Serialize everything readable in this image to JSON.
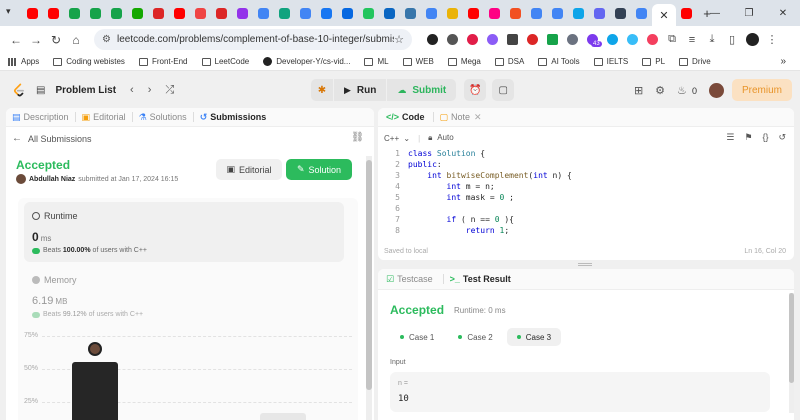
{
  "browser": {
    "tab_favicons": [
      {
        "icon": "youtube-icon",
        "color": "#ff0000"
      },
      {
        "icon": "youtube-icon",
        "color": "#ff0000"
      },
      {
        "icon": "green-app-icon",
        "color": "#16a34a"
      },
      {
        "icon": "green-app-icon",
        "color": "#16a34a"
      },
      {
        "icon": "green-app-icon",
        "color": "#16a34a"
      },
      {
        "icon": "upwork-icon",
        "color": "#14a800"
      },
      {
        "icon": "gmail-icon",
        "color": "#dc2626"
      },
      {
        "icon": "youtube-icon",
        "color": "#ff0000"
      },
      {
        "icon": "red-app-icon",
        "color": "#ef4444"
      },
      {
        "icon": "gmail-icon",
        "color": "#dc2626"
      },
      {
        "icon": "purple-app-icon",
        "color": "#9333ea"
      },
      {
        "icon": "google-icon",
        "color": "#4285f4"
      },
      {
        "icon": "chatgpt-icon",
        "color": "#10a37f"
      },
      {
        "icon": "google-icon",
        "color": "#4285f4"
      },
      {
        "icon": "facebook-icon",
        "color": "#1877f2"
      },
      {
        "icon": "meta-icon",
        "color": "#0668e1"
      },
      {
        "icon": "green-app-icon",
        "color": "#22c55e"
      },
      {
        "icon": "linkedin-icon",
        "color": "#0a66c2"
      },
      {
        "icon": "python-icon",
        "color": "#3776ab"
      },
      {
        "icon": "google-icon",
        "color": "#4285f4"
      },
      {
        "icon": "yellow-app-icon",
        "color": "#eab308"
      },
      {
        "icon": "youtube-icon",
        "color": "#ff0000"
      },
      {
        "icon": "flickr-icon",
        "color": "#ff0084"
      },
      {
        "icon": "microsoft-icon",
        "color": "#f25022"
      },
      {
        "icon": "chrome-icon",
        "color": "#4285f4"
      },
      {
        "icon": "google-icon",
        "color": "#4285f4"
      },
      {
        "icon": "blue-app-icon",
        "color": "#0ea5e9"
      },
      {
        "icon": "shield-icon",
        "color": "#6366f1"
      },
      {
        "icon": "hat-icon",
        "color": "#334155"
      },
      {
        "icon": "google-icon",
        "color": "#4285f4"
      }
    ],
    "trailing_favicon": {
      "icon": "youtube-icon",
      "color": "#ff0000"
    },
    "active_tab_close": "✕",
    "new_tab": "+",
    "window_controls": [
      "—",
      "❐",
      "✕"
    ],
    "url": "leetcode.com/problems/complement-of-base-10-integer/submission...",
    "extension_badge": "43",
    "bookmarks": [
      {
        "label": "Apps",
        "icon": "apps-grid-icon"
      },
      {
        "label": "Coding webistes",
        "icon": "folder-icon"
      },
      {
        "label": "Front-End",
        "icon": "folder-icon"
      },
      {
        "label": "LeetCode",
        "icon": "folder-icon"
      },
      {
        "label": "Developer-Y/cs-vid...",
        "icon": "github-icon"
      },
      {
        "label": "ML",
        "icon": "folder-icon"
      },
      {
        "label": "WEB",
        "icon": "folder-icon"
      },
      {
        "label": "Mega",
        "icon": "folder-icon"
      },
      {
        "label": "DSA",
        "icon": "folder-icon"
      },
      {
        "label": "AI Tools",
        "icon": "folder-icon"
      },
      {
        "label": "IELTS",
        "icon": "folder-icon"
      },
      {
        "label": "PL",
        "icon": "folder-icon"
      },
      {
        "label": "Drive",
        "icon": "folder-icon"
      }
    ],
    "bookmarks_more": "»"
  },
  "header": {
    "problem_list": "Problem List",
    "run": "Run",
    "submit": "Submit",
    "streak_count": "0",
    "premium": "Premium"
  },
  "left_panel": {
    "tabs": [
      "Description",
      "Editorial",
      "Solutions",
      "Submissions"
    ],
    "all_submissions": "All Submissions",
    "status": "Accepted",
    "author": "Abdullah Niaz",
    "submitted_at": "submitted at Jan 17, 2024 16:15",
    "editorial_button": "Editorial",
    "solution_button": "Solution",
    "runtime": {
      "label": "Runtime",
      "value": "0",
      "unit": "ms",
      "beats_prefix": "Beats",
      "beats_pct": "100.00%",
      "beats_suffix": "of users with C++"
    },
    "memory": {
      "label": "Memory",
      "value": "6.19",
      "unit": "MB",
      "beats_prefix": "Beats",
      "beats_pct": "99.12%",
      "beats_suffix": "of users with C++"
    }
  },
  "chart_data": {
    "type": "bar",
    "y_ticks": [
      "75%",
      "50%",
      "25%"
    ],
    "yunit": "%",
    "ylim": [
      0,
      100
    ],
    "values": [
      55,
      17
    ]
  },
  "code_panel": {
    "tabs": [
      "Code",
      "Note"
    ],
    "language": "C++",
    "mode": "Auto",
    "lines": [
      {
        "n": "1",
        "segments": [
          {
            "t": "class ",
            "c": "kw"
          },
          {
            "t": "Solution",
            "c": "ty"
          },
          {
            "t": " {",
            "c": ""
          }
        ]
      },
      {
        "n": "2",
        "segments": [
          {
            "t": "public",
            "c": "kw"
          },
          {
            "t": ":",
            "c": ""
          }
        ]
      },
      {
        "n": "3",
        "segments": [
          {
            "t": "    ",
            "c": ""
          },
          {
            "t": "int ",
            "c": "kw"
          },
          {
            "t": "bitwiseComplement",
            "c": "fn"
          },
          {
            "t": "(",
            "c": ""
          },
          {
            "t": "int ",
            "c": "kw"
          },
          {
            "t": "n) {",
            "c": ""
          }
        ]
      },
      {
        "n": "4",
        "segments": [
          {
            "t": "        ",
            "c": ""
          },
          {
            "t": "int ",
            "c": "kw"
          },
          {
            "t": "m = n;",
            "c": ""
          }
        ]
      },
      {
        "n": "5",
        "segments": [
          {
            "t": "        ",
            "c": ""
          },
          {
            "t": "int ",
            "c": "kw"
          },
          {
            "t": "mask = ",
            "c": ""
          },
          {
            "t": "0",
            "c": "nm"
          },
          {
            "t": " ;",
            "c": ""
          }
        ]
      },
      {
        "n": "6",
        "segments": [
          {
            "t": "",
            "c": ""
          }
        ]
      },
      {
        "n": "7",
        "segments": [
          {
            "t": "        ",
            "c": ""
          },
          {
            "t": "if",
            "c": "kw"
          },
          {
            "t": " ( n == ",
            "c": ""
          },
          {
            "t": "0",
            "c": "nm"
          },
          {
            "t": " ){",
            "c": ""
          }
        ]
      },
      {
        "n": "8",
        "segments": [
          {
            "t": "            ",
            "c": ""
          },
          {
            "t": "return ",
            "c": "kw"
          },
          {
            "t": "1",
            "c": "nm"
          },
          {
            "t": ";",
            "c": ""
          }
        ]
      }
    ],
    "saved_status": "Saved to local",
    "cursor": "Ln 16, Col 20"
  },
  "test_panel": {
    "tabs": [
      "Testcase",
      "Test Result"
    ],
    "status": "Accepted",
    "runtime": "Runtime: 0 ms",
    "cases": [
      "Case 1",
      "Case 2",
      "Case 3"
    ],
    "input_label": "Input",
    "input_var": "n =",
    "input_value": "10"
  }
}
